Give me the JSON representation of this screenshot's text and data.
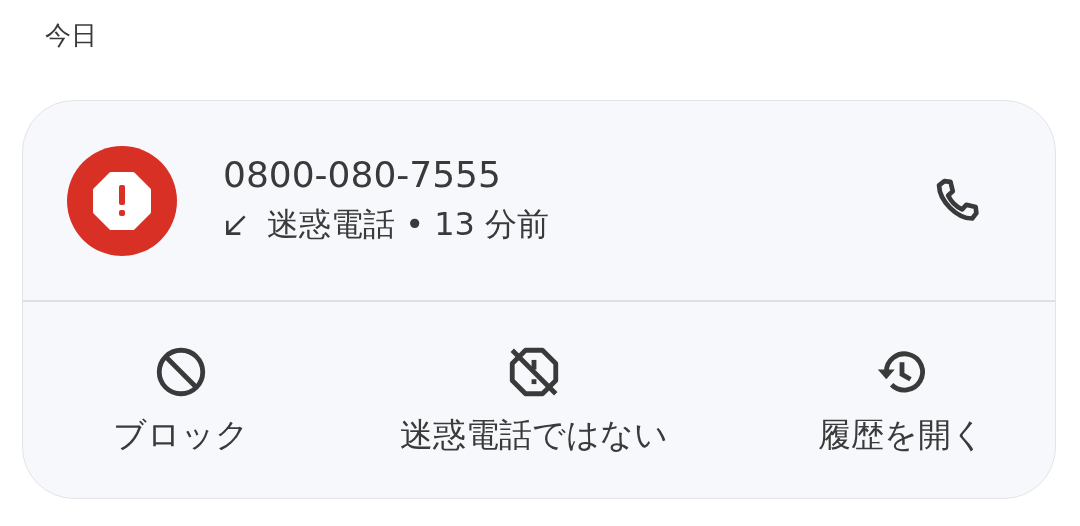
{
  "section_title": "今日",
  "call": {
    "number": "0800-080-7555",
    "detail": "迷惑電話 • 13 分前"
  },
  "actions": [
    {
      "kind": "block",
      "label": "ブロック"
    },
    {
      "kind": "not-spam",
      "label": "迷惑電話ではない"
    },
    {
      "kind": "history",
      "label": "履歴を開く"
    }
  ]
}
